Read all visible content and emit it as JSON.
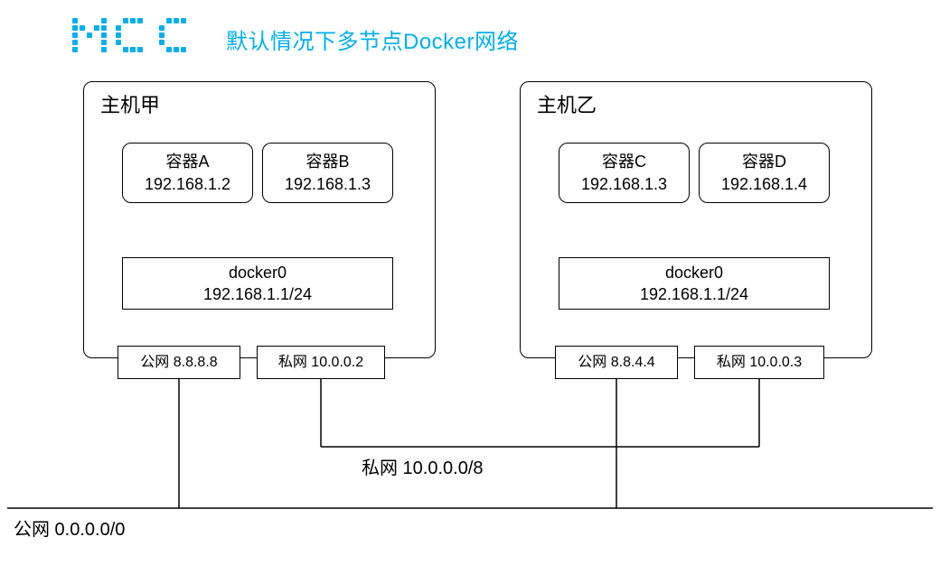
{
  "title": "默认情况下多节点Docker网络",
  "hostA": {
    "title": "主机甲",
    "containerA": {
      "name": "容器A",
      "ip": "192.168.1.2"
    },
    "containerB": {
      "name": "容器B",
      "ip": "192.168.1.3"
    },
    "bridge": {
      "name": "docker0",
      "cidr": "192.168.1.1/24"
    },
    "public": "公网 8.8.8.8",
    "private": "私网 10.0.0.2"
  },
  "hostB": {
    "title": "主机乙",
    "containerC": {
      "name": "容器C",
      "ip": "192.168.1.3"
    },
    "containerD": {
      "name": "容器D",
      "ip": "192.168.1.4"
    },
    "bridge": {
      "name": "docker0",
      "cidr": "192.168.1.1/24"
    },
    "public": "公网 8.8.4.4",
    "private": "私网 10.0.0.3"
  },
  "privateNet": "私网 10.0.0.0/8",
  "publicNet": "公网 0.0.0.0/0"
}
